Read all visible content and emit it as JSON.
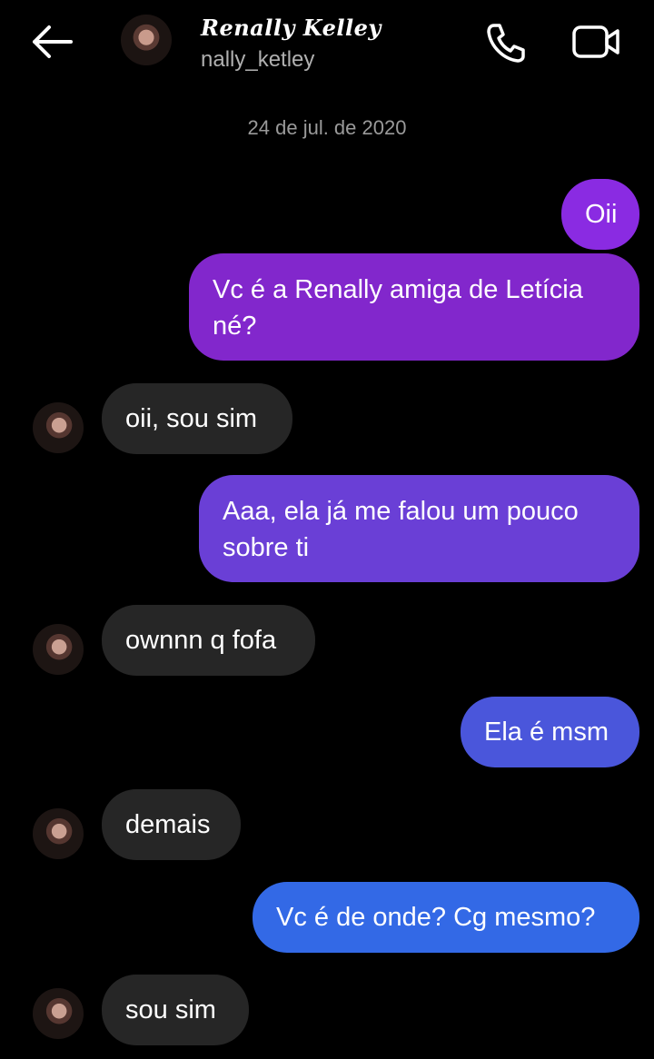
{
  "header": {
    "display_name": "Renally Kelley",
    "username": "nally_ketley",
    "back_icon": "arrow-left-icon",
    "call_icon": "phone-icon",
    "video_icon": "video-camera-icon"
  },
  "conversation": {
    "date": "24 de jul. de 2020",
    "messages": [
      {
        "sender": "me",
        "text": "Oii",
        "color": "#8a2be2"
      },
      {
        "sender": "me",
        "text": "Vc é a Renally amiga de Letícia né?",
        "color": "#8227cc"
      },
      {
        "sender": "them",
        "text": "oii, sou sim"
      },
      {
        "sender": "me",
        "text": "Aaa, ela já me falou um pouco sobre ti",
        "color": "#6a3fd6"
      },
      {
        "sender": "them",
        "text": "ownnn q fofa"
      },
      {
        "sender": "me",
        "text": "Ela é msm",
        "color": "#4a56db"
      },
      {
        "sender": "them",
        "text": "demais"
      },
      {
        "sender": "me",
        "text": "Vc é de onde? Cg mesmo?",
        "color": "#3369e6"
      },
      {
        "sender": "them",
        "text": "sou sim"
      }
    ]
  }
}
